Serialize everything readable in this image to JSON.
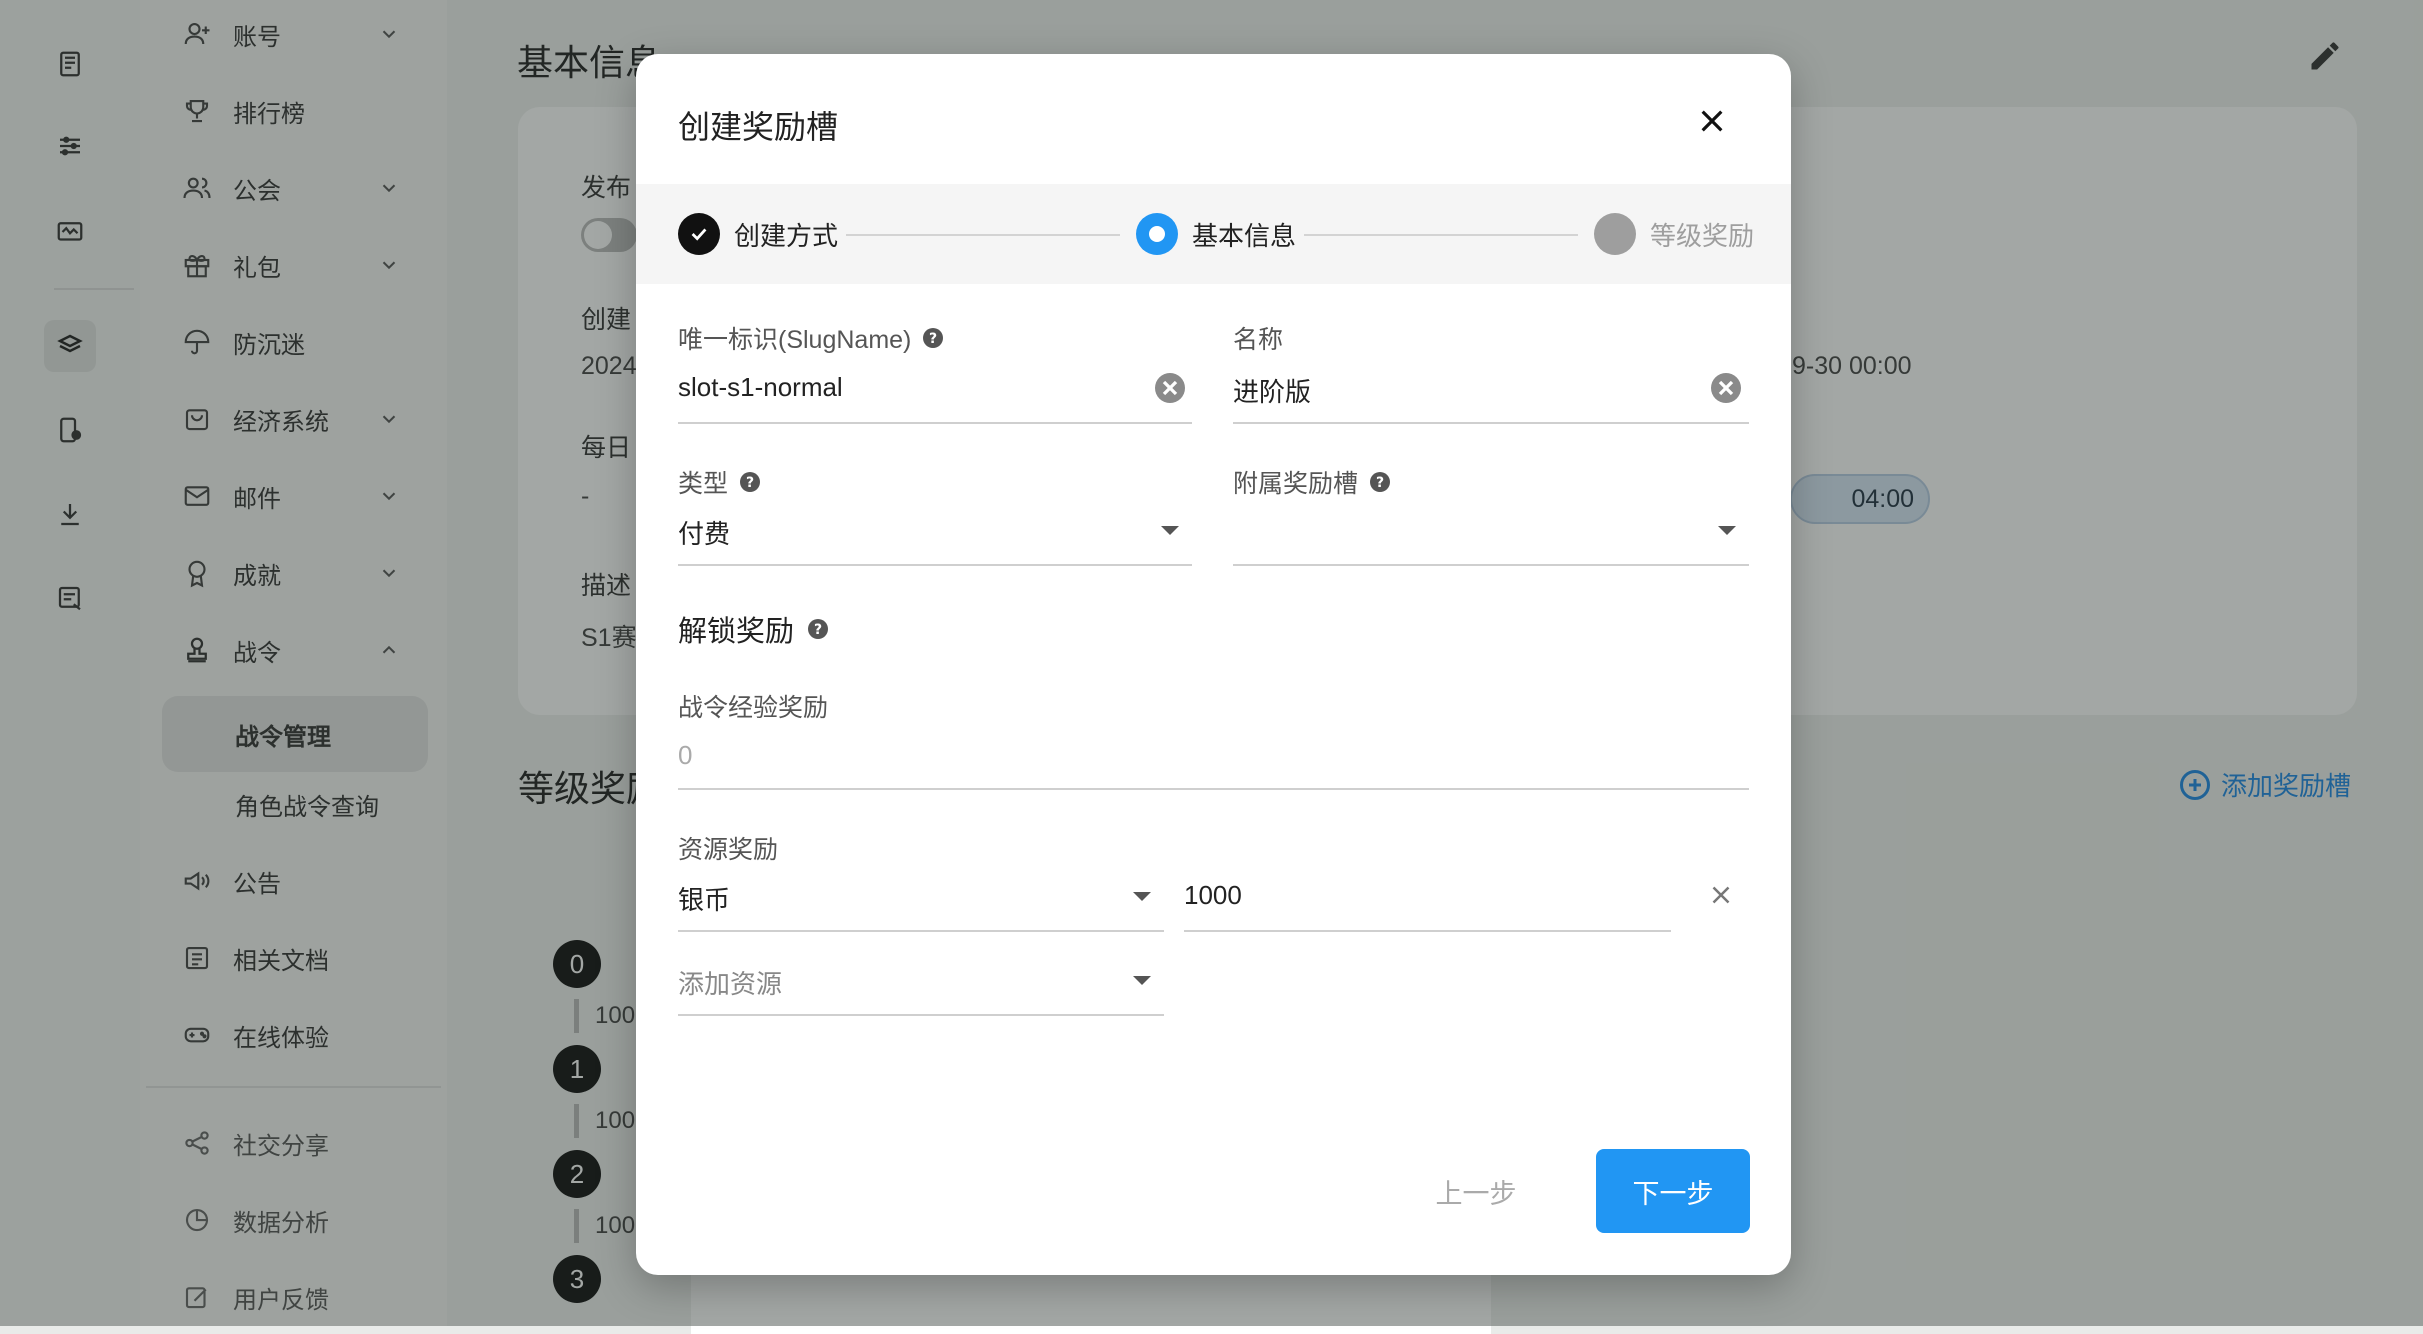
{
  "nav": {
    "items": [
      {
        "label": "账号",
        "icon": "person-add-icon",
        "chevron": true
      },
      {
        "label": "排行榜",
        "icon": "trophy-icon",
        "chevron": false
      },
      {
        "label": "公会",
        "icon": "group-icon",
        "chevron": true
      },
      {
        "label": "礼包",
        "icon": "gift-icon",
        "chevron": true
      },
      {
        "label": "防沉迷",
        "icon": "umbrella-icon",
        "chevron": false
      },
      {
        "label": "经济系统",
        "icon": "bag-icon",
        "chevron": true
      },
      {
        "label": "邮件",
        "icon": "mail-icon",
        "chevron": true
      },
      {
        "label": "成就",
        "icon": "medal-icon",
        "chevron": true
      },
      {
        "label": "战令",
        "icon": "stamp-icon",
        "chevron": true,
        "expanded": true
      }
    ],
    "sub_items": [
      {
        "label": "战令管理",
        "active": true
      },
      {
        "label": "角色战令查询",
        "active": false
      }
    ],
    "more_items": [
      {
        "label": "公告",
        "icon": "megaphone-icon"
      },
      {
        "label": "相关文档",
        "icon": "document-icon"
      },
      {
        "label": "在线体验",
        "icon": "gamepad-icon"
      }
    ],
    "bottom_items": [
      {
        "label": "社交分享",
        "icon": "share-icon"
      },
      {
        "label": "数据分析",
        "icon": "pie-chart-icon"
      },
      {
        "label": "用户反馈",
        "icon": "feedback-icon"
      }
    ]
  },
  "background": {
    "page_title": "基本信息",
    "labels": {
      "publish": "发布",
      "created": "创建",
      "daily": "每日",
      "description": "描述"
    },
    "values": {
      "created": "2024",
      "daily": "-",
      "description": "S1赛",
      "end_time": "9-30 00:00",
      "chip": "04:00"
    },
    "section2_title": "等级奖励",
    "add_slot_label": "添加奖励槽",
    "levels": [
      {
        "level": "0",
        "text": "100"
      },
      {
        "level": "1",
        "text": "100"
      },
      {
        "level": "2",
        "text": "100"
      },
      {
        "level": "3",
        "text": ""
      }
    ]
  },
  "dialog": {
    "title": "创建奖励槽",
    "steps": [
      {
        "label": "创建方式",
        "state": "done"
      },
      {
        "label": "基本信息",
        "state": "current"
      },
      {
        "label": "等级奖励",
        "state": "pending"
      }
    ],
    "fields": {
      "slug_label": "唯一标识(SlugName)",
      "slug_value": "slot-s1-normal",
      "name_label": "名称",
      "name_value": "进阶版",
      "type_label": "类型",
      "type_value": "付费",
      "parent_label": "附属奖励槽",
      "parent_value": ""
    },
    "unlock_title": "解锁奖励",
    "exp_label": "战令经验奖励",
    "exp_placeholder": "0",
    "resource_label": "资源奖励",
    "resources": [
      {
        "type": "银币",
        "amount": "1000"
      }
    ],
    "add_resource_placeholder": "添加资源",
    "buttons": {
      "prev": "上一步",
      "next": "下一步"
    }
  },
  "colors": {
    "accent": "#2196f3",
    "done_step": "#111111",
    "pending_step": "#9e9e9e"
  }
}
